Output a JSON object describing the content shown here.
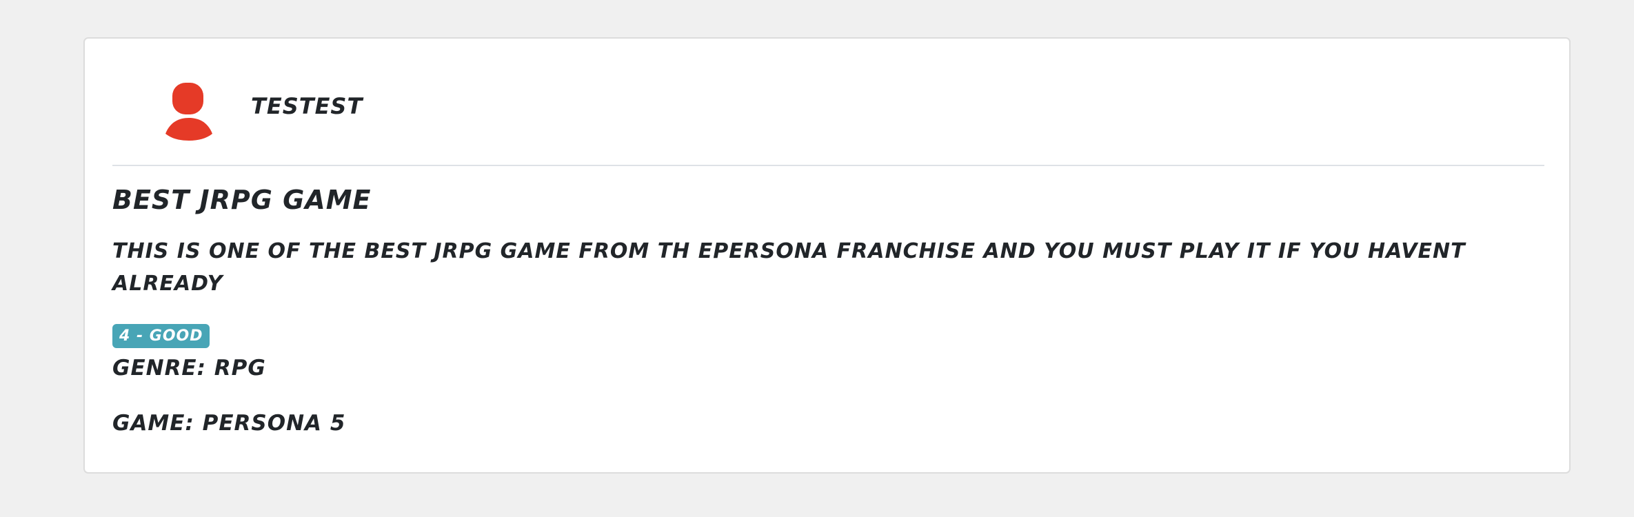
{
  "review": {
    "username": "TESTEST",
    "title": "BEST JRPG GAME",
    "text": "THIS IS ONE OF THE BEST JRPG GAME FROM TH EPERSONA FRANCHISE AND YOU MUST PLAY IT IF YOU HAVENT ALREADY",
    "rating_badge": "4 - GOOD",
    "genre_line": "GENRE: RPG",
    "game_line": "GAME: PERSONA 5"
  },
  "icons": {
    "avatar": "user-avatar-icon"
  },
  "colors": {
    "avatar": "#e53a27",
    "badge": "#48a5b6",
    "text": "#212529",
    "page_background": "#f0f0f0",
    "card_background": "#ffffff"
  }
}
